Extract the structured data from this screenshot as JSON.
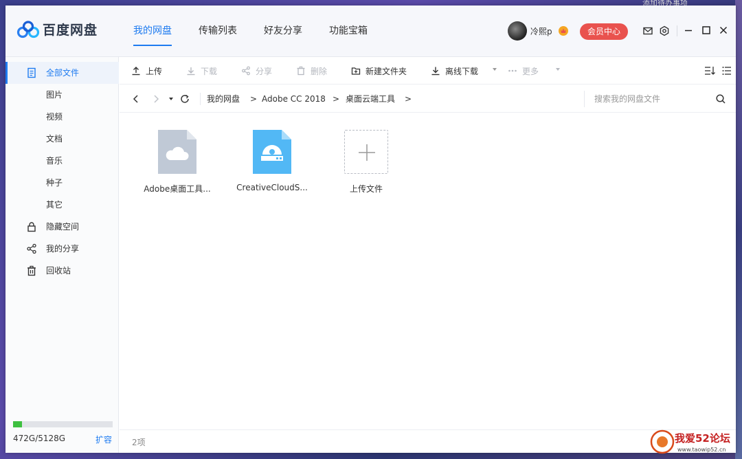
{
  "desktop": {
    "top_text": "添加待办事项"
  },
  "app": {
    "name": "百度网盘",
    "nav": [
      {
        "label": "我的网盘",
        "active": true
      },
      {
        "label": "传输列表",
        "active": false
      },
      {
        "label": "好友分享",
        "active": false
      },
      {
        "label": "功能宝箱",
        "active": false
      }
    ],
    "user": {
      "name": "冷熙p"
    },
    "vip_button": "会员中心"
  },
  "sidebar": {
    "items": [
      {
        "label": "全部文件",
        "icon": "file-icon",
        "active": true
      },
      {
        "label": "图片"
      },
      {
        "label": "视频"
      },
      {
        "label": "文档"
      },
      {
        "label": "音乐"
      },
      {
        "label": "种子"
      },
      {
        "label": "其它"
      },
      {
        "label": "隐藏空间",
        "icon": "lock-icon"
      },
      {
        "label": "我的分享",
        "icon": "share-icon"
      },
      {
        "label": "回收站",
        "icon": "trash-icon"
      }
    ],
    "storage": {
      "used_fraction": 0.092,
      "text": "472G/5128G",
      "expand": "扩容"
    }
  },
  "toolbar": {
    "upload": "上传",
    "download": "下载",
    "share": "分享",
    "delete": "删除",
    "new_folder": "新建文件夹",
    "offline_download": "离线下载",
    "more": "更多"
  },
  "address": {
    "crumbs": [
      "我的网盘",
      "Adobe CC 2018",
      "桌面云端工具"
    ],
    "separator": ">",
    "search_placeholder": "搜索我的网盘文件"
  },
  "files": [
    {
      "name": "Adobe桌面工具...",
      "icon": "cloud-file-icon",
      "color": "#c0c9d6"
    },
    {
      "name": "CreativeCloudS...",
      "icon": "installer-file-icon",
      "color": "#52b8f5"
    }
  ],
  "upload_tile": {
    "label": "上传文件"
  },
  "status": {
    "count": "2项"
  },
  "watermark": {
    "text": "我爱52论坛",
    "url": "www.taowip52.cn"
  },
  "colors": {
    "accent": "#1e7bf0",
    "vip": "#e9524e",
    "storage": "#3ec040"
  }
}
